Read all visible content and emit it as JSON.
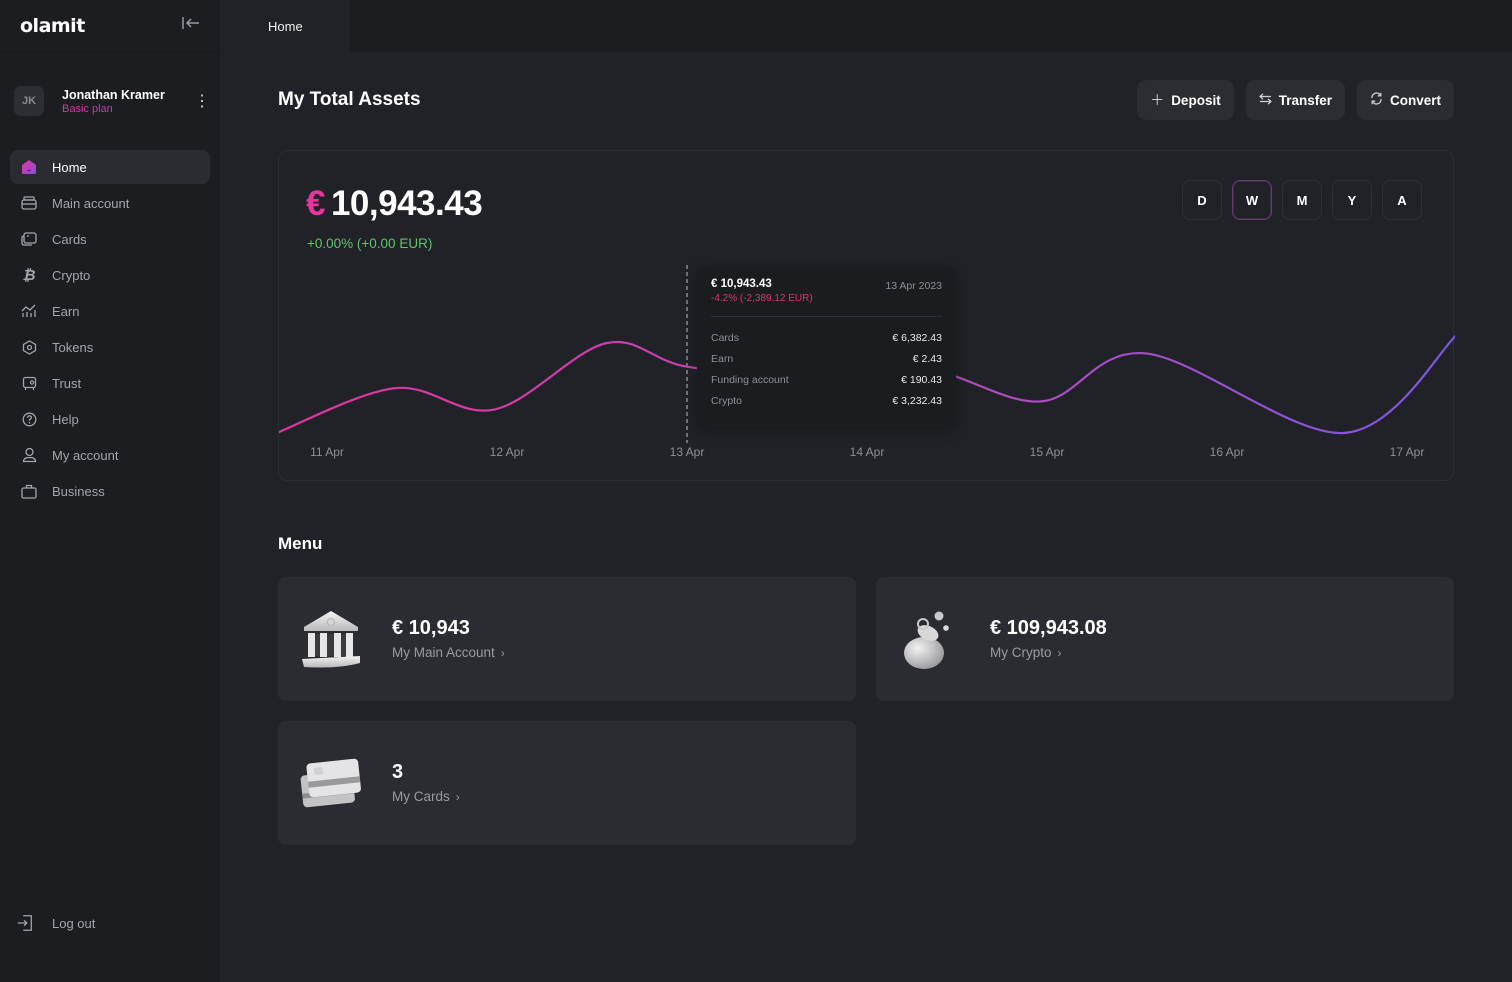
{
  "app": {
    "logo": "olamit",
    "collapse_icon": "collapse-sidebar-icon"
  },
  "profile": {
    "initials": "JK",
    "name": "Jonathan Kramer",
    "plan": "Basic plan"
  },
  "sidebar": {
    "items": [
      {
        "label": "Home",
        "icon": "home-icon",
        "active": true
      },
      {
        "label": "Main account",
        "icon": "wallet-icon"
      },
      {
        "label": "Cards",
        "icon": "cards-icon"
      },
      {
        "label": "Crypto",
        "icon": "bitcoin-icon"
      },
      {
        "label": "Earn",
        "icon": "chart-growth-icon"
      },
      {
        "label": "Tokens",
        "icon": "token-icon"
      },
      {
        "label": "Trust",
        "icon": "safe-icon"
      },
      {
        "label": "Help",
        "icon": "help-icon"
      },
      {
        "label": "My account",
        "icon": "user-icon"
      },
      {
        "label": "Business",
        "icon": "briefcase-icon"
      }
    ],
    "logout": "Log out"
  },
  "tabs": [
    {
      "label": "Home"
    }
  ],
  "header": {
    "title": "My Total Assets",
    "actions": [
      {
        "label": "Deposit",
        "icon": "plus-icon"
      },
      {
        "label": "Transfer",
        "icon": "transfer-icon"
      },
      {
        "label": "Convert",
        "icon": "convert-icon"
      }
    ]
  },
  "summary": {
    "currency_symbol": "€",
    "total": "10,943.43",
    "change": "+0.00% (+0.00 EUR)",
    "ranges": [
      "D",
      "W",
      "M",
      "Y",
      "A"
    ],
    "active_range": "W"
  },
  "tooltip": {
    "total": "€ 10,943.43",
    "change": "-4.2% (-2,389.12 EUR)",
    "date": "13 Apr 2023",
    "rows": [
      {
        "label": "Cards",
        "value": "€ 6,382.43"
      },
      {
        "label": "Earn",
        "value": "€ 2.43"
      },
      {
        "label": "Funding account",
        "value": "€ 190.43"
      },
      {
        "label": "Crypto",
        "value": "€ 3,232.43"
      }
    ]
  },
  "chart_data": {
    "type": "line",
    "title": "",
    "xlabel": "",
    "ylabel": "",
    "x": [
      "11 Apr",
      "12 Apr",
      "13 Apr",
      "14 Apr",
      "15 Apr",
      "16 Apr",
      "17 Apr"
    ],
    "series": [
      {
        "name": "Total assets",
        "points": [
          [
            -0.28,
            0.0
          ],
          [
            0.38,
            0.44
          ],
          [
            0.93,
            0.23
          ],
          [
            1.55,
            0.88
          ],
          [
            2.0,
            0.65
          ],
          [
            2.72,
            0.55
          ],
          [
            3.34,
            0.62
          ],
          [
            3.97,
            0.31
          ],
          [
            4.55,
            0.78
          ],
          [
            5.65,
            0.0
          ],
          [
            6.28,
            0.97
          ]
        ]
      }
    ],
    "y_unit": "relative (no axis shown)",
    "ylim": [
      0,
      1
    ],
    "highlight_x": "13 Apr",
    "gradient": [
      "#e0359c",
      "#7b57e0"
    ],
    "grid": false,
    "legend": "none"
  },
  "menu": {
    "title": "Menu",
    "cards": [
      {
        "amount": "€ 10,943",
        "label": "My Main Account",
        "illustration": "bank-illustration"
      },
      {
        "amount": "€ 109,943.08",
        "label": "My Crypto",
        "illustration": "coin-bag-illustration"
      },
      {
        "amount": "3",
        "label": "My Cards",
        "illustration": "cards-illustration"
      }
    ]
  }
}
